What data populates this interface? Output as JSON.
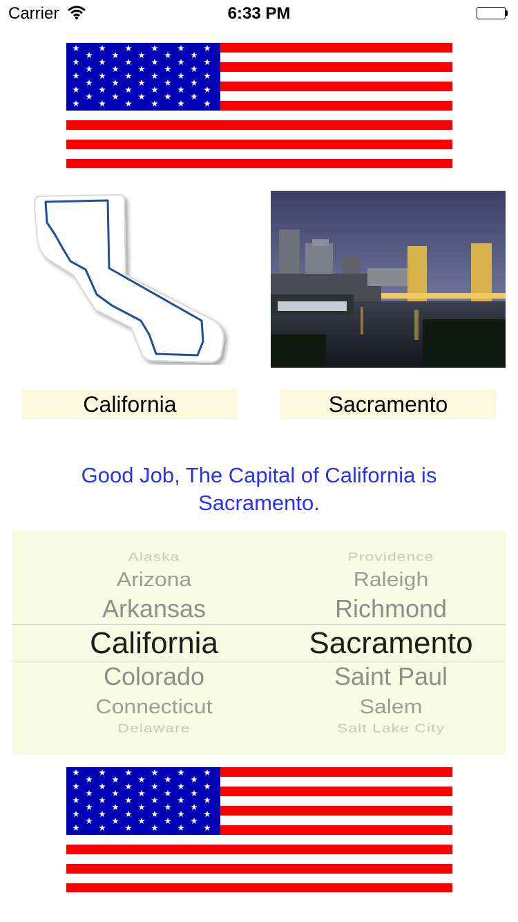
{
  "status_bar": {
    "carrier": "Carrier",
    "time": "6:33 PM",
    "wifi_icon": "wifi-icon",
    "battery_icon": "battery-icon"
  },
  "colors": {
    "flag_red": "#ff0000",
    "flag_blue": "#0000b4",
    "label_bg": "#fdf9df",
    "feedback_text": "#2733ee",
    "picker_bg": "#f7fbe1"
  },
  "selection": {
    "state": "California",
    "capital": "Sacramento"
  },
  "feedback": {
    "line1": "Good Job, The Capital of California is",
    "line2": "Sacramento."
  },
  "picker": {
    "states": [
      "Alaska",
      "Arizona",
      "Arkansas",
      "California",
      "Colorado",
      "Connecticut",
      "Delaware"
    ],
    "capitals": [
      "Providence",
      "Raleigh",
      "Richmond",
      "Sacramento",
      "Saint Paul",
      "Salem",
      "Salt Lake City"
    ]
  }
}
